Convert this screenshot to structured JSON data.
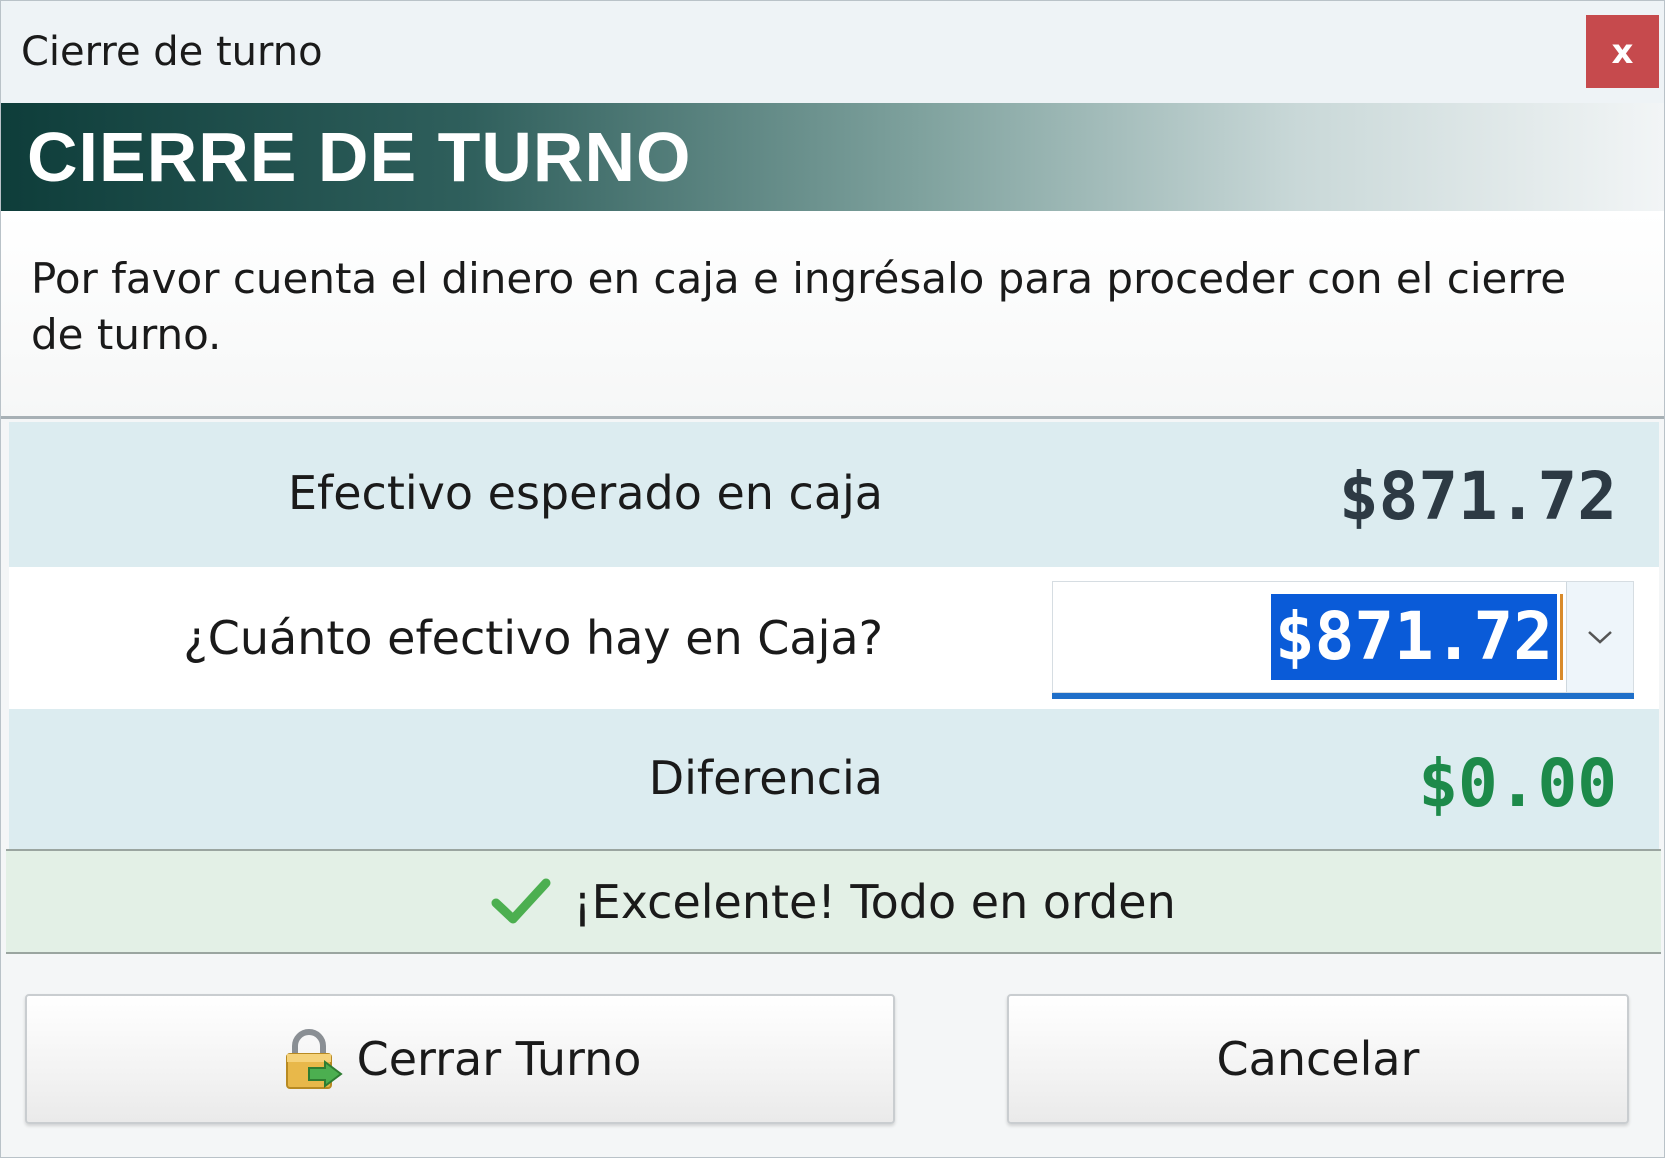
{
  "window": {
    "title": "Cierre de turno",
    "close_label": "x"
  },
  "banner": {
    "heading": "CIERRE DE TURNO"
  },
  "instructions": {
    "text": "Por favor cuenta el dinero en caja e ingrésalo para proceder con el cierre de turno."
  },
  "fields": {
    "expected": {
      "label": "Efectivo esperado en caja",
      "value": "$871.72"
    },
    "counted": {
      "label": "¿Cuánto efectivo hay en Caja?",
      "value": "$871.72"
    },
    "difference": {
      "label": "Diferencia",
      "value": "$0.00"
    }
  },
  "status": {
    "message": "¡Excelente! Todo en orden",
    "icon": "checkmark-icon"
  },
  "buttons": {
    "close_shift": {
      "label": "Cerrar Turno",
      "icon": "lock-exit-icon"
    },
    "cancel": {
      "label": "Cancelar"
    }
  },
  "colors": {
    "success": "#1d8a4a",
    "selection": "#0a5bd8",
    "close_button": "#c64a4d",
    "banner_dark": "#0e3d3a"
  }
}
